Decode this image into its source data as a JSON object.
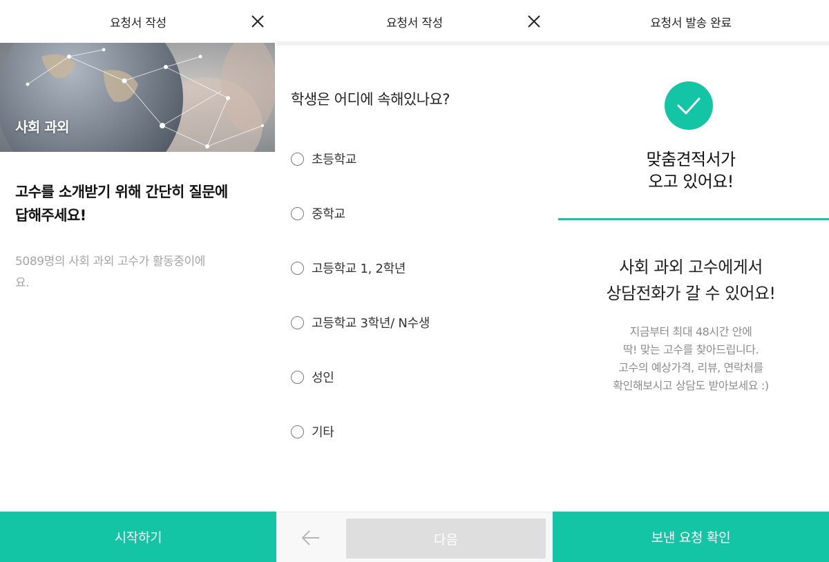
{
  "colors": {
    "accent": "#14c5a5",
    "disabled": "#dedede",
    "muted_text": "#a6a6a6"
  },
  "screen1": {
    "header_title": "요청서 작성",
    "hero_label": "사회 과외",
    "heading_line1": "고수를 소개받기 위해 간단히 질문에",
    "heading_line2": "답해주세요!",
    "sub_line1": "5089명의 사회 과외 고수가 활동중이에",
    "sub_line2": "요.",
    "start_button": "시작하기"
  },
  "screen2": {
    "header_title": "요청서 작성",
    "question": "학생은 어디에 속해있나요?",
    "options": [
      "초등학교",
      "중학교",
      "고등학교 1, 2학년",
      "고등학교 3학년/ N수생",
      "성인",
      "기타"
    ],
    "next_button": "다음"
  },
  "screen3": {
    "header_title": "요청서 발송 완료",
    "heading_line1": "맞춤견적서가",
    "heading_line2": "오고 있어요!",
    "sub_line1": "사회 과외 고수에게서",
    "sub_line2": "상담전화가 갈 수 있어요!",
    "desc": [
      "지금부터 최대 48시간 안에",
      "딱! 맞는 고수를 찾아드립니다.",
      "고수의 예상가격, 리뷰, 연락처를",
      "확인해보시고 상담도 받아보세요 :)"
    ],
    "confirm_button": "보낸 요청 확인"
  }
}
